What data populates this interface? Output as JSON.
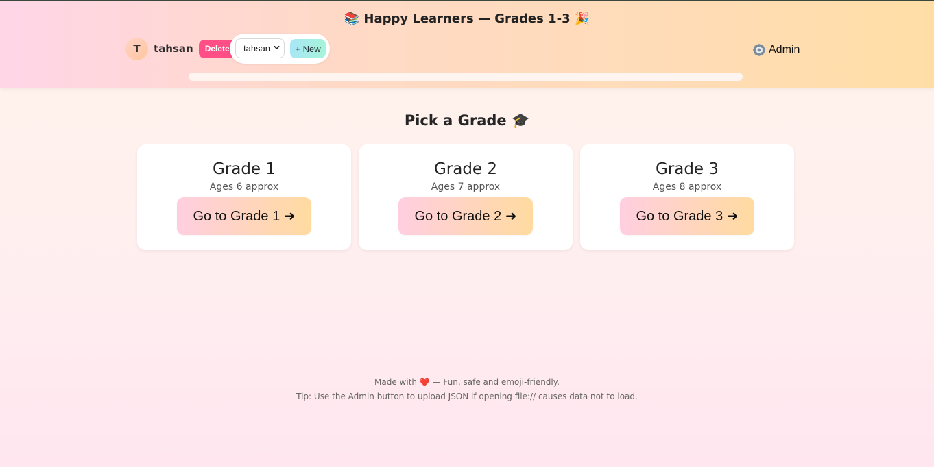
{
  "app": {
    "title": "📚 Happy Learners — Grades 1-3 🎉"
  },
  "user": {
    "avatar_initial": "T",
    "name": "tahsan",
    "delete_label": "Delete"
  },
  "profile_switcher": {
    "selected": "tahsan",
    "new_label": "+ New"
  },
  "admin": {
    "label": "Admin",
    "icon": "gear-icon"
  },
  "progress": {
    "percent": 0
  },
  "main": {
    "heading": "Pick a Grade 🎓",
    "grades": [
      {
        "title": "Grade 1",
        "subtitle": "Ages 6 approx",
        "button": "Go to Grade 1 ➜"
      },
      {
        "title": "Grade 2",
        "subtitle": "Ages 7 approx",
        "button": "Go to Grade 2 ➜"
      },
      {
        "title": "Grade 3",
        "subtitle": "Ages 8 approx",
        "button": "Go to Grade 3 ➜"
      }
    ]
  },
  "footer": {
    "line1": "Made with ❤️ — Fun, safe and emoji-friendly.",
    "line2": "Tip: Use the Admin button to upload JSON if opening file:// causes data not to load."
  },
  "colors": {
    "delete": "#ff4f86",
    "accent_pink": "#ffcfe0",
    "accent_orange": "#ffdba0",
    "new_button": "#a8e6f7"
  }
}
